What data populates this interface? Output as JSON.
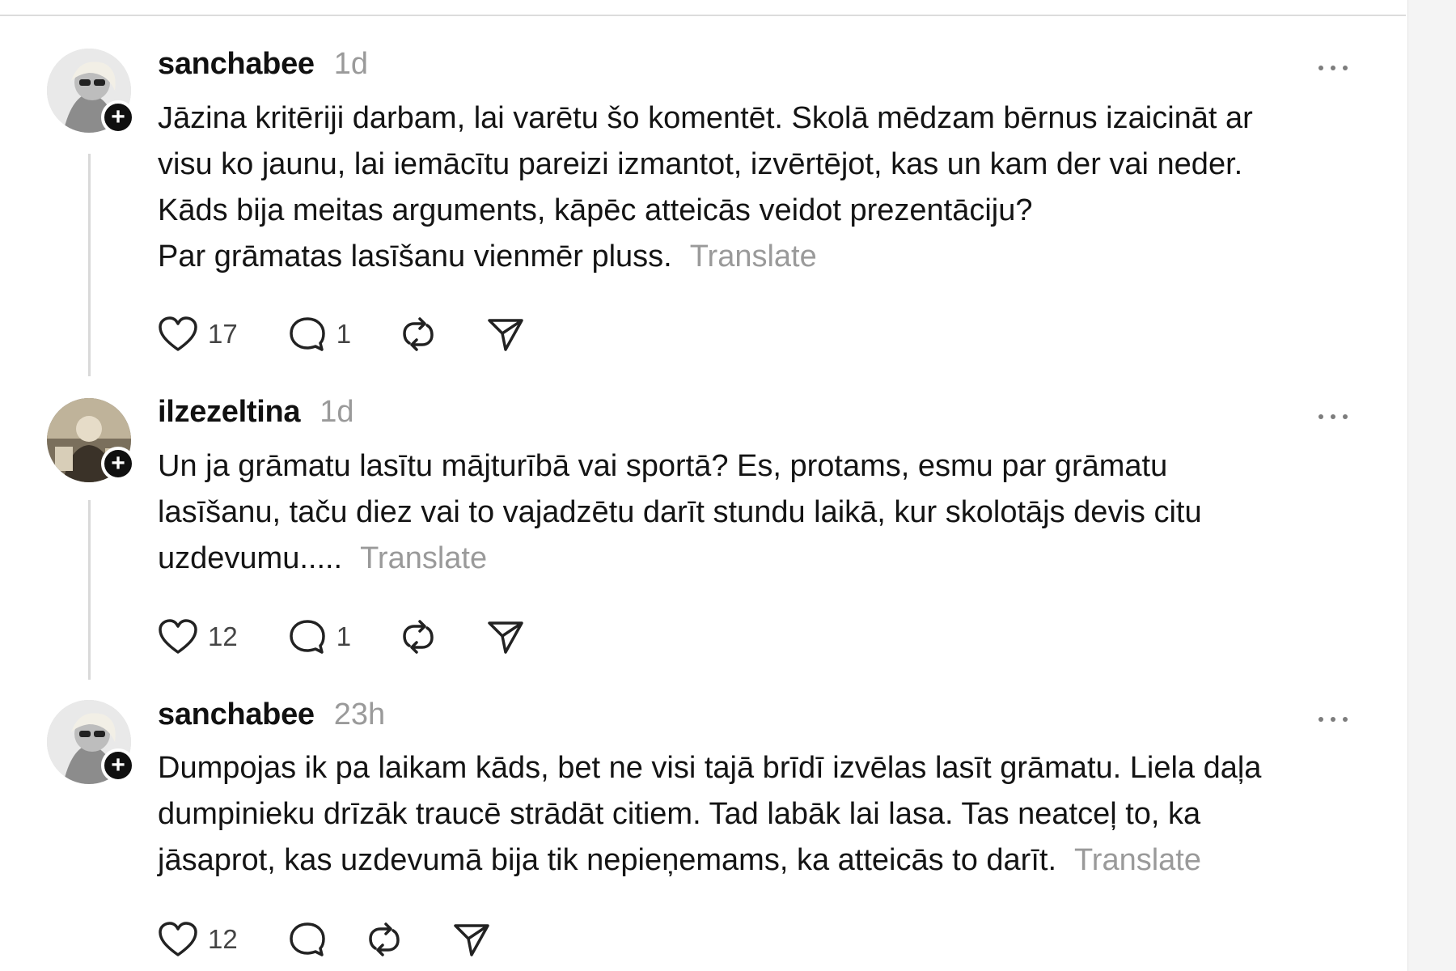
{
  "posts": [
    {
      "username": "sanchabee",
      "time": "1d",
      "lines": [
        "Jāzina kritēriji darbam, lai varētu šo komentēt. Skolā mēdzam bērnus izaicināt ar",
        "visu ko jaunu, lai iemācītu pareizi izmantot, izvērtējot, kas un kam der vai neder.",
        "Kāds bija meitas arguments, kāpēc atteicās veidot prezentāciju?",
        "Par grāmatas lasīšanu vienmēr pluss."
      ],
      "translate": "Translate",
      "likes": "17",
      "replies": "1"
    },
    {
      "username": "ilzezeltina",
      "time": "1d",
      "lines": [
        "Un ja grāmatu lasītu mājturībā vai sportā? Es, protams, esmu par grāmatu",
        "lasīšanu, taču diez vai to vajadzētu darīt stundu laikā, kur skolotājs devis citu",
        "uzdevumu....."
      ],
      "translate": "Translate",
      "likes": "12",
      "replies": "1"
    },
    {
      "username": "sanchabee",
      "time": "23h",
      "lines": [
        "Dumpojas ik pa laikam kāds, bet ne visi tajā brīdī izvēlas lasīt grāmatu. Liela daļa",
        "dumpinieku drīzāk traucē strādāt citiem. Tad labāk lai lasa. Tas neatceļ to, ka",
        "jāsaprot, kas uzdevumā bija tik nepieņemams, ka atteicās to darīt."
      ],
      "translate": "Translate",
      "likes": "12",
      "replies": ""
    }
  ],
  "icons": {
    "like": "heart-icon",
    "reply": "speech-bubble-icon",
    "repost": "repost-icon",
    "share": "send-icon",
    "follow": "plus-icon",
    "more": "ellipsis-icon"
  },
  "colors": {
    "text": "#141414",
    "muted": "#9a9a9a",
    "thread_line": "#d9d9d9"
  }
}
